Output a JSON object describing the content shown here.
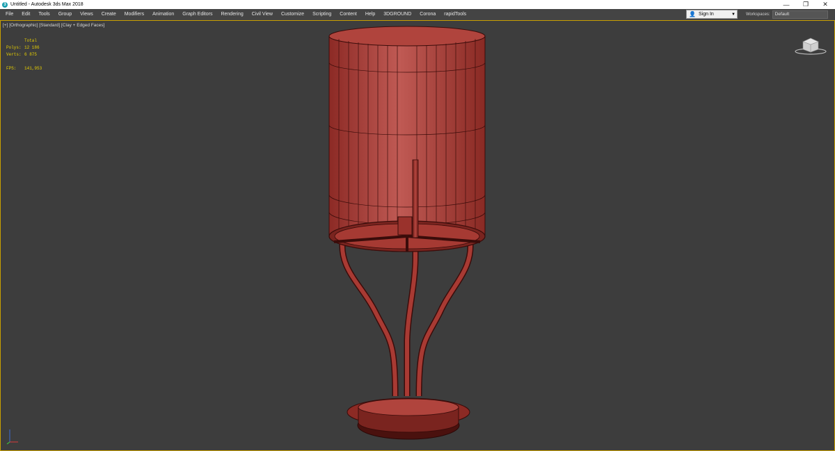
{
  "window": {
    "title": "Untitled - Autodesk 3ds Max 2018",
    "app_icon": "3",
    "controls": [
      "—",
      "❐",
      "✕"
    ]
  },
  "menu": {
    "items": [
      "File",
      "Edit",
      "Tools",
      "Group",
      "Views",
      "Create",
      "Modifiers",
      "Animation",
      "Graph Editors",
      "Rendering",
      "Civil View",
      "Customize",
      "Scripting",
      "Content",
      "Help",
      "3DGROUND",
      "Corona",
      "rapidTools"
    ]
  },
  "account": {
    "signin_label": "Sign In",
    "workspaces_label": "Workspaces:",
    "workspace_value": "Default"
  },
  "viewport": {
    "label": "[+] [Orthographic] [Standard] [Clay + Edged Faces]",
    "stats": {
      "header": "Total",
      "polys_label": "Polys:",
      "polys_value": "12 186",
      "verts_label": "Verts:",
      "verts_value": "6 875",
      "fps_label": "FPS:",
      "fps_value": "141,953"
    }
  },
  "colors": {
    "model_fill": "#a83a33",
    "model_edge": "#3a0c0a",
    "viewport_border": "#c9a000",
    "stats_text": "#e8d000"
  }
}
